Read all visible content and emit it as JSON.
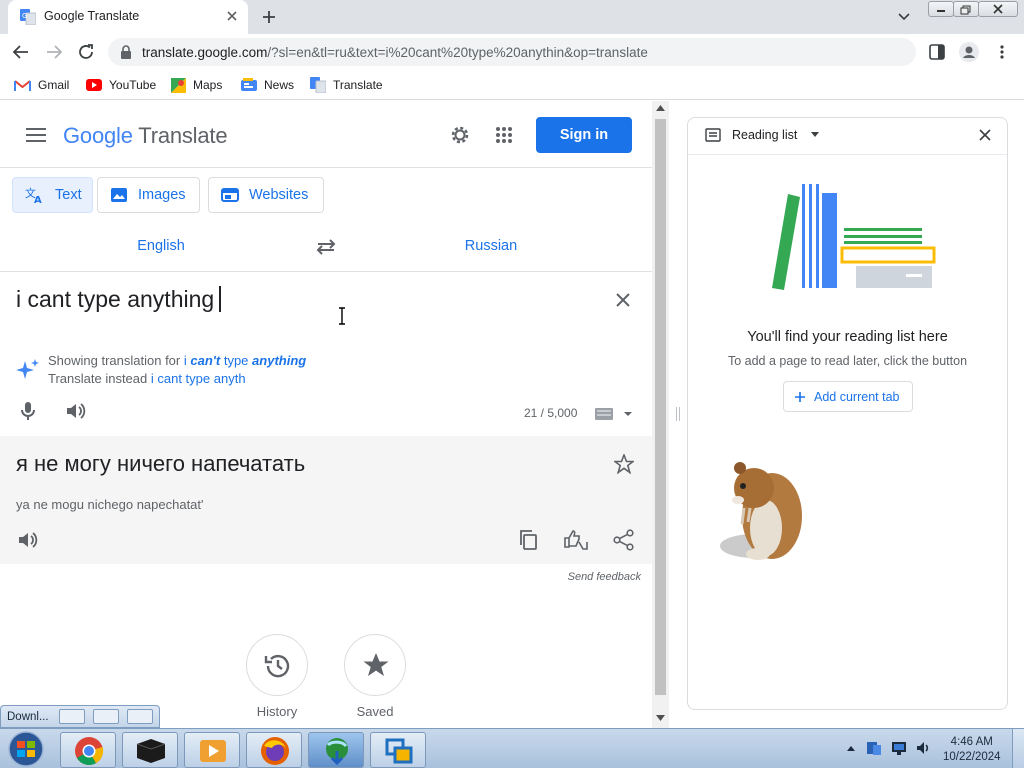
{
  "browser": {
    "tab_title": "Google Translate",
    "url_host": "translate.google.com",
    "url_rest": "/?sl=en&tl=ru&text=i%20cant%20type%20anythin&op=translate",
    "bookmarks": [
      "Gmail",
      "YouTube",
      "Maps",
      "News",
      "Translate"
    ]
  },
  "header": {
    "logo_google": "Google",
    "logo_translate": "Translate",
    "sign_in": "Sign in"
  },
  "modes": {
    "text": "Text",
    "images": "Images",
    "websites": "Websites"
  },
  "languages": {
    "source": "English",
    "target": "Russian"
  },
  "source": {
    "text": "i cant type anything",
    "showing_prefix": "Showing translation for",
    "showing_i": "i",
    "showing_cant": "can't",
    "showing_type": "type",
    "showing_anything": "anything",
    "instead_prefix": "Translate instead",
    "instead_text": "i cant type anyth",
    "char_count": "21 / 5,000"
  },
  "target": {
    "text": "я не могу ничего напечатать",
    "transliteration": "ya ne mogu nichego napechatat'",
    "send_feedback": "Send feedback"
  },
  "bottom": {
    "history": "History",
    "saved": "Saved"
  },
  "reading_list": {
    "title": "Reading list",
    "empty_title": "You'll find your reading list here",
    "empty_sub": "To add a page to read later, click the button",
    "add_button": "Add current tab"
  },
  "taskbar": {
    "download_popup": "Downl...",
    "time": "4:46 AM",
    "date": "10/22/2024"
  },
  "colors": {
    "accent": "#1a73e8",
    "google_blue": "#4285f4",
    "google_red": "#ea4335",
    "google_yellow": "#fbbc04",
    "google_green": "#34a853"
  }
}
